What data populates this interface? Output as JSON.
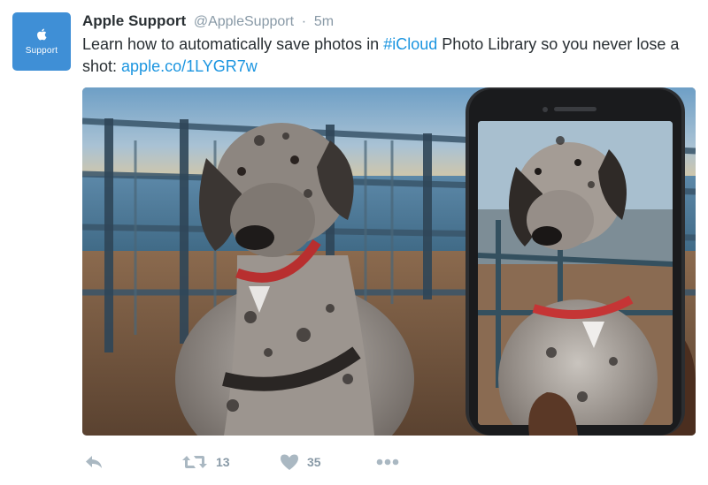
{
  "tweet": {
    "avatar": {
      "label": "Support",
      "icon": "apple-logo-icon",
      "color": "#3f8fd6"
    },
    "author_name": "Apple Support",
    "handle": "@AppleSupport",
    "separator": "·",
    "time": "5m",
    "text_before": "Learn how to automatically save photos in ",
    "hashtag": "#iCloud",
    "text_after": " Photo Library so you never lose a shot: ",
    "link": "apple.co/1LYGR7w",
    "media": {
      "icon": "dog-on-pier-photo",
      "description_visible": false
    },
    "actions": {
      "reply": {
        "icon": "reply-icon"
      },
      "retweet": {
        "icon": "retweet-icon",
        "count": "13"
      },
      "like": {
        "icon": "heart-icon",
        "count": "35"
      },
      "more": {
        "icon": "more-dots-icon"
      }
    },
    "colors": {
      "link": "#1b95e0",
      "muted": "#8899a6",
      "icon": "#aab8c2"
    }
  }
}
